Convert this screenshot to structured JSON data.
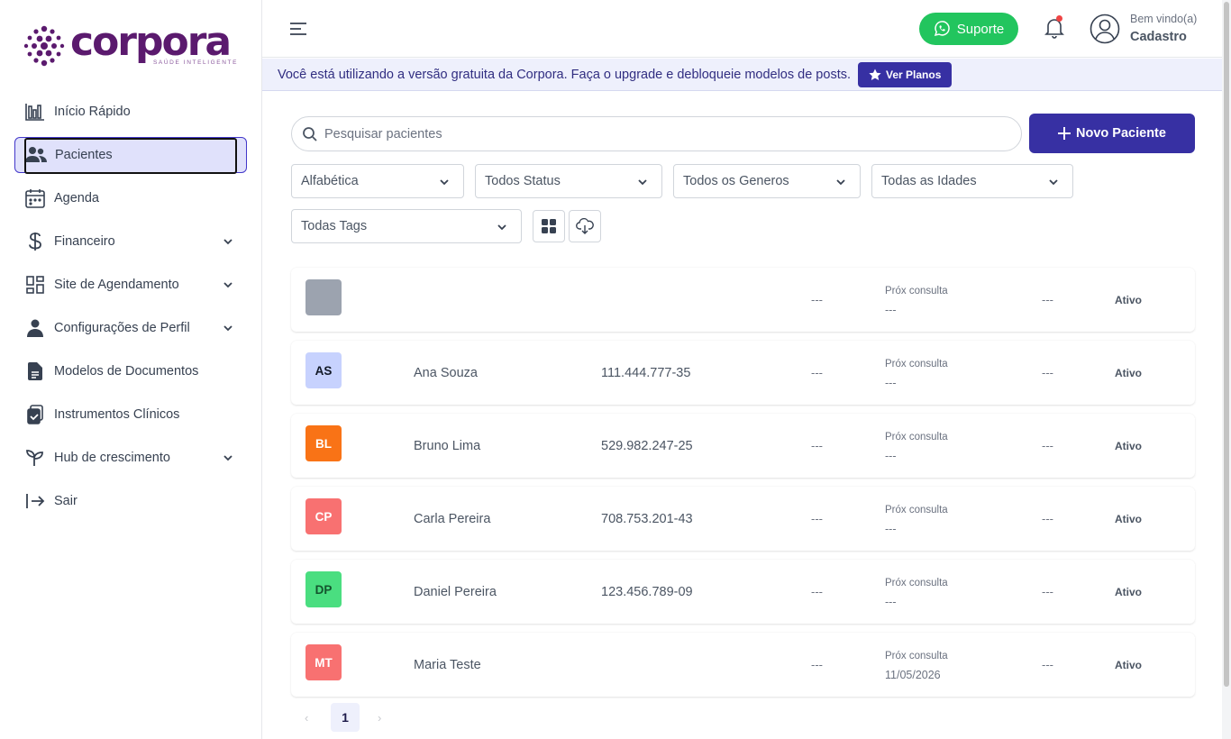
{
  "brand": {
    "name": "corpora",
    "tagline": "SAÚDE INTELIGENTE",
    "color": "#5b1a6e"
  },
  "sidebar": {
    "items": [
      {
        "label": "Início Rápido",
        "icon": "bar-chart-icon",
        "expandable": false
      },
      {
        "label": "Pacientes",
        "icon": "users-icon",
        "expandable": false,
        "active": true
      },
      {
        "label": "Agenda",
        "icon": "calendar-icon",
        "expandable": false
      },
      {
        "label": "Financeiro",
        "icon": "dollar-icon",
        "expandable": true
      },
      {
        "label": "Site de Agendamento",
        "icon": "dashboard-icon",
        "expandable": true
      },
      {
        "label": "Configurações de Perfil",
        "icon": "person-icon",
        "expandable": true
      },
      {
        "label": "Modelos de Documentos",
        "icon": "document-icon",
        "expandable": false
      },
      {
        "label": "Instrumentos Clínicos",
        "icon": "clipboard-icon",
        "expandable": false
      },
      {
        "label": "Hub de crescimento",
        "icon": "sprout-icon",
        "expandable": true
      },
      {
        "label": "Sair",
        "icon": "logout-icon",
        "expandable": false
      }
    ]
  },
  "header": {
    "support_label": "Suporte",
    "welcome": "Bem vindo(a)",
    "username": "Cadastro"
  },
  "banner": {
    "text": "Você está utilizando a versão gratuita da Corpora. Faça o upgrade e debloqueie modelos de posts.",
    "button": "Ver Planos"
  },
  "search": {
    "placeholder": "Pesquisar pacientes",
    "value": ""
  },
  "new_patient_label": "Novo Paciente",
  "filters": {
    "sort": "Alfabética",
    "status": "Todos Status",
    "gender": "Todos os Generos",
    "age": "Todas as Idades",
    "tags": "Todas Tags"
  },
  "patients": [
    {
      "initials": "",
      "name": "",
      "cpf": "",
      "phone": "---",
      "next_label": "Próx consulta",
      "next_value": "---",
      "extra": "---",
      "status": "Ativo",
      "color": "#9ca3af",
      "text_color": "#ffffff"
    },
    {
      "initials": "AS",
      "name": "Ana Souza",
      "cpf": "111.444.777-35",
      "phone": "---",
      "next_label": "Próx consulta",
      "next_value": "---",
      "extra": "---",
      "status": "Ativo",
      "color": "#c7d2fe",
      "text_color": "#111827"
    },
    {
      "initials": "BL",
      "name": "Bruno Lima",
      "cpf": "529.982.247-25",
      "phone": "---",
      "next_label": "Próx consulta",
      "next_value": "---",
      "extra": "---",
      "status": "Ativo",
      "color": "#f97316",
      "text_color": "#ffffff"
    },
    {
      "initials": "CP",
      "name": "Carla Pereira",
      "cpf": "708.753.201-43",
      "phone": "---",
      "next_label": "Próx consulta",
      "next_value": "---",
      "extra": "---",
      "status": "Ativo",
      "color": "#f87171",
      "text_color": "#ffffff"
    },
    {
      "initials": "DP",
      "name": "Daniel Pereira",
      "cpf": "123.456.789-09",
      "phone": "---",
      "next_label": "Próx consulta",
      "next_value": "---",
      "extra": "---",
      "status": "Ativo",
      "color": "#4ade80",
      "text_color": "#14532d"
    },
    {
      "initials": "MT",
      "name": "Maria Teste",
      "cpf": "",
      "phone": "---",
      "next_label": "Próx consulta",
      "next_value": "11/05/2026",
      "extra": "---",
      "status": "Ativo",
      "color": "#f87171",
      "text_color": "#ffffff"
    }
  ],
  "pagination": {
    "prev": "‹",
    "current": "1",
    "next": "›"
  }
}
